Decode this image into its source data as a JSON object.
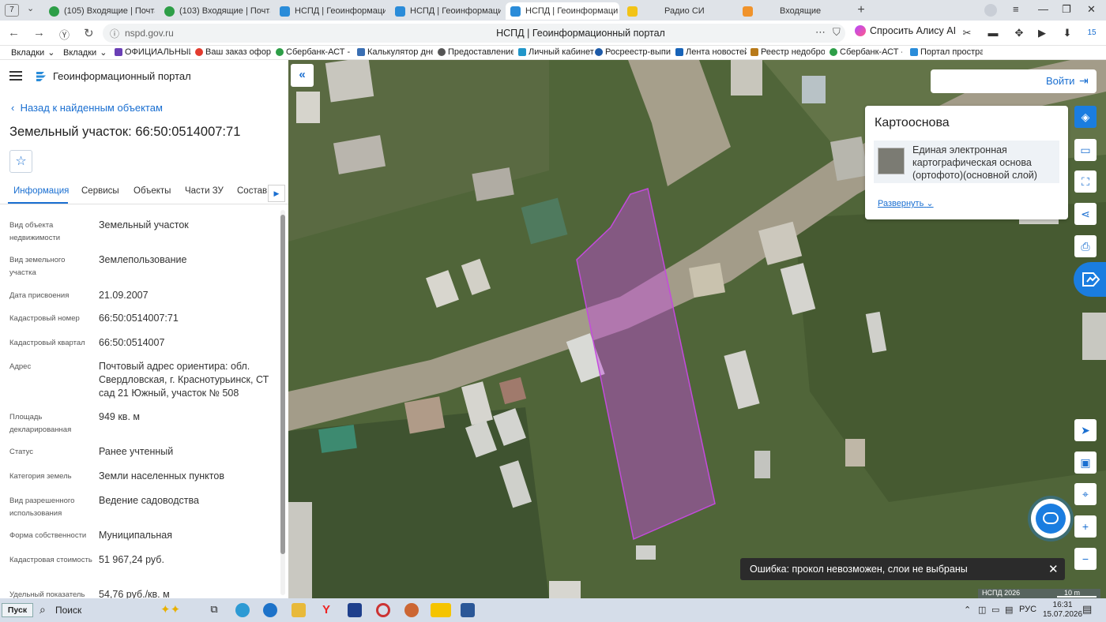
{
  "browser": {
    "tab_count": "7",
    "tabs": [
      {
        "label": "(105) Входящие | Почта |",
        "color": "#2d9e47"
      },
      {
        "label": "(103) Входящие | Почта | 5",
        "color": "#2d9e47"
      },
      {
        "label": "НСПД | Геоинформацион",
        "color": "#2a8cd9"
      },
      {
        "label": "НСПД | Геоинформацион",
        "color": "#2a8cd9"
      },
      {
        "label": "НСПД | Геоинформаци",
        "color": "#2a8cd9"
      },
      {
        "label": "Радио СИ",
        "color": "#f2c316"
      },
      {
        "label": "Входящие",
        "color": "#f0932b"
      }
    ],
    "url": "nspd.gov.ru",
    "page_title": "НСПД | Геоинформационный портал",
    "alice_label": "Спросить Алису AI",
    "badge": "15",
    "bookmarks": [
      {
        "label": "Вкладки",
        "color": "#ffffff"
      },
      {
        "label": "Вкладки",
        "color": "#ffffff"
      },
      {
        "label": "ОФИЦИАЛЬНЫЙ",
        "color": "#6a3fb5"
      },
      {
        "label": "Ваш заказ оформ",
        "color": "#e33b2e"
      },
      {
        "label": "Сбербанк-АСТ - з",
        "color": "#2d9e47"
      },
      {
        "label": "Калькулятор дне",
        "color": "#3a6fb3"
      },
      {
        "label": "Предоставление",
        "color": "#555555"
      },
      {
        "label": "Личный кабинет",
        "color": "#2196c9"
      },
      {
        "label": "Росреестр-выпис",
        "color": "#1d5aa8"
      },
      {
        "label": "Лента новостей",
        "color": "#1763b8"
      },
      {
        "label": "Реестр недоброс",
        "color": "#b87a1a"
      },
      {
        "label": "Сбербанк-АСТ - з",
        "color": "#2d9e47"
      },
      {
        "label": "Портал простран",
        "color": "#2a8cd9"
      }
    ]
  },
  "panel": {
    "portal_name": "Геоинформационный портал",
    "back_label": "Назад к найденным объектам",
    "title": "Земельный участок: 66:50:0514007:71",
    "tabs": [
      "Информация",
      "Сервисы",
      "Объекты",
      "Части ЗУ",
      "Состав"
    ],
    "rows": [
      {
        "label": "Вид объекта недвижимости",
        "value": "Земельный участок"
      },
      {
        "label": "Вид земельного участка",
        "value": "Землепользование"
      },
      {
        "label": "Дата присвоения",
        "value": "21.09.2007"
      },
      {
        "label": "Кадастровый номер",
        "value": "66:50:0514007:71"
      },
      {
        "label": "Кадастровый квартал",
        "value": "66:50:0514007"
      },
      {
        "label": "Адрес",
        "value": "Почтовый адрес ориентира: обл. Свердловская, г. Краснотурьинск, СТ сад 21 Южный, участок № 508"
      },
      {
        "label": "Площадь декларированная",
        "value": "949 кв. м"
      },
      {
        "label": "Статус",
        "value": "Ранее учтенный"
      },
      {
        "label": "Категория земель",
        "value": "Земли населенных пунктов"
      },
      {
        "label": "Вид разрешенного использования",
        "value": "Ведение садоводства"
      },
      {
        "label": "Форма собственности",
        "value": "Муниципальная"
      },
      {
        "label": "Кадастровая стоимость",
        "value": "51 967,24 руб."
      },
      {
        "label": "Удельный показатель",
        "value": "54,76 руб./кв. м"
      }
    ]
  },
  "map": {
    "login_label": "Войти",
    "basemap_title": "Картооснова",
    "basemap_layer": "Единая электронная картографическая основа (ортофото)(основной слой)",
    "expand_label": "Развернуть",
    "toast": "Ошибка: прокол невозможен, слои не выбраны",
    "copyright": "НСПД 2026",
    "scale_label": "10 m",
    "parcel_color": "#c34bdc"
  },
  "taskbar": {
    "start_label": "Пуск",
    "search_label": "Поиск",
    "lang": "РУС",
    "time": "16:31",
    "date": "15.07.2026"
  }
}
